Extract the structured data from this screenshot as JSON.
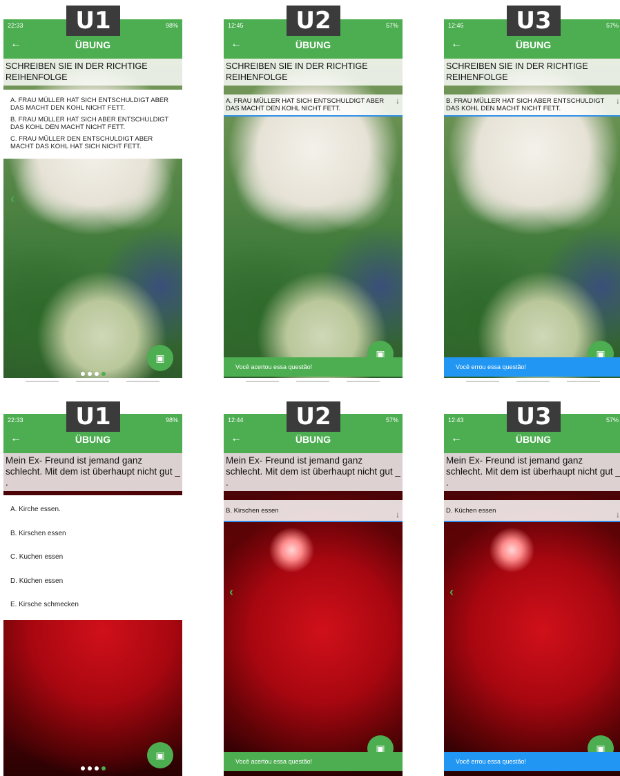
{
  "app": {
    "title": "ÜBUNG",
    "back_icon": "arrow-left-icon",
    "save_icon": "save-icon"
  },
  "labels": {
    "u1": "U1",
    "u2": "U2",
    "u3": "U3"
  },
  "colors": {
    "green": "#4cae50",
    "blue": "#2196f3"
  },
  "row1": {
    "question": "SCHREIBEN SIE IN DER RICHTIGE REIHENFOLGE",
    "u1": {
      "time": "22:33",
      "status_right": "98%",
      "options": [
        "A. FRAU MÜLLER HAT SICH ENTSCHULDIGT ABER DAS MACHT DEN KOHL NICHT FETT.",
        "B. FRAU MÜLLER HAT SICH ABER ENTSCHULDIGT DAS KOHL DEN MACHT NICHT FETT.",
        "C. FRAU MÜLLER DEN ENTSCHULDIGT ABER MACHT DAS KOHL HAT SICH NICHT FETT."
      ]
    },
    "u2": {
      "time": "12:45",
      "status_right": "57%",
      "selected": "A. FRAU MÜLLER HAT SICH ENTSCHULDIGT ABER DAS MACHT DEN KOHL NICHT FETT.",
      "feedback": "Você acertou essa questão!"
    },
    "u3": {
      "time": "12:45",
      "status_right": "57%",
      "selected": "B. FRAU MÜLLER HAT SICH ABER ENTSCHULDIGT DAS KOHL DEN MACHT NICHT FETT.",
      "feedback": "Você errou essa questão!"
    }
  },
  "row2": {
    "question": "Mein Ex- Freund ist jemand ganz schlecht. Mit dem ist überhaupt nicht gut _ .",
    "u1": {
      "time": "22:33",
      "status_right": "98%",
      "options": [
        "A. Kirche essen.",
        "B. Kirschen essen",
        "C. Kuchen essen",
        "D. Küchen essen",
        "E. Kirsche schmecken"
      ]
    },
    "u2": {
      "time": "12:44",
      "status_right": "57%",
      "selected": "B. Kirschen essen",
      "feedback": "Você acertou essa questão!"
    },
    "u3": {
      "time": "12:43",
      "status_right": "57%",
      "selected": "D. Küchen essen",
      "feedback": "Você errou essa questão!"
    }
  }
}
